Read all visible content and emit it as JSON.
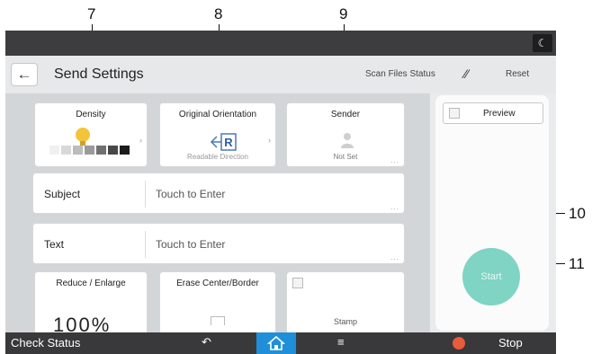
{
  "callouts": {
    "c7": "7",
    "c8": "8",
    "c9": "9",
    "c10": "10",
    "c11": "11"
  },
  "header": {
    "title": "Send Settings",
    "scan_files_status": "Scan Files Status",
    "reset": "Reset"
  },
  "tiles": {
    "density": {
      "label": "Density",
      "level": 3,
      "levels": 7
    },
    "orientation": {
      "label": "Original Orientation",
      "value": "Readable Direction"
    },
    "sender": {
      "label": "Sender",
      "value": "Not Set"
    }
  },
  "rows": {
    "subject": {
      "label": "Subject",
      "placeholder": "Touch to Enter"
    },
    "text": {
      "label": "Text",
      "placeholder": "Touch to Enter"
    }
  },
  "tiles2": {
    "reduce": {
      "label": "Reduce / Enlarge",
      "value": "100%"
    },
    "erase": {
      "label": "Erase Center/Border"
    },
    "stamp": {
      "label": "Stamp"
    }
  },
  "right_panel": {
    "preview": "Preview",
    "start": "Start"
  },
  "bottom_bar": {
    "check_status": "Check Status",
    "stop": "Stop"
  },
  "colors": {
    "accent_home": "#1f8fd9",
    "start": "#7fd4c4",
    "stop": "#e85b3c",
    "bulb": "#f3c43a"
  }
}
